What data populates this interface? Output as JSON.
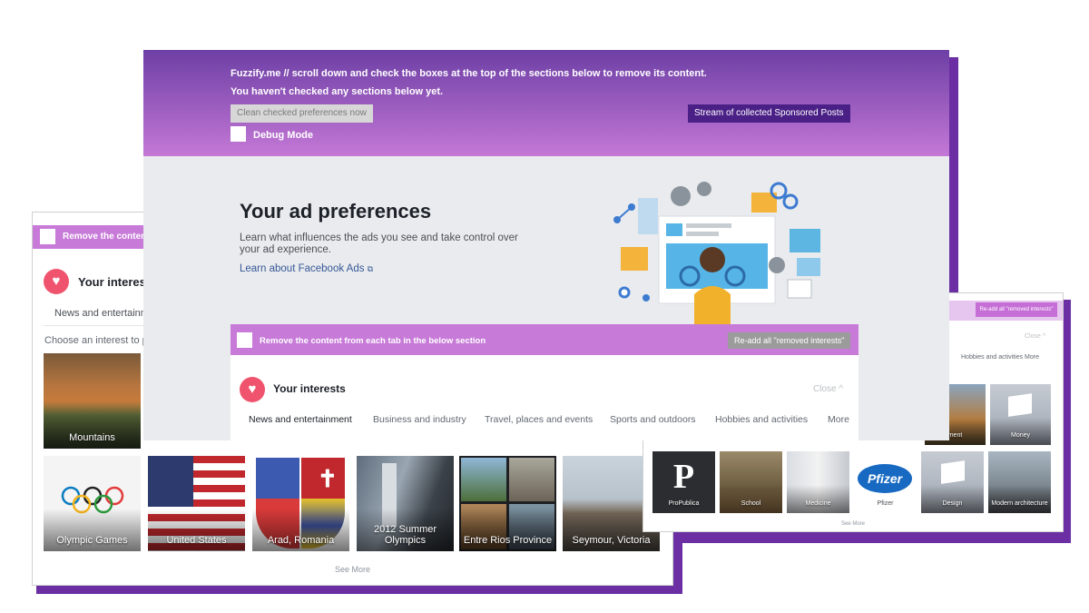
{
  "header": {
    "line1": "Fuzzify.me // scroll down and check the boxes at the top of the sections below to remove its content.",
    "line2": "You haven't checked any sections below yet.",
    "clean_button": "Clean checked preferences now",
    "stream_button": "Stream of collected Sponsored Posts",
    "debug_label": "Debug Mode"
  },
  "ad_prefs": {
    "title": "Your ad preferences",
    "description": "Learn what influences the ads you see and take control over your ad experience.",
    "link": "Learn about Facebook Ads"
  },
  "main_section": {
    "remove_text": "Remove the content from each tab in the below section",
    "readd_button": "Re-add all \"removed interests\"",
    "interests_title": "Your interests",
    "close": "Close",
    "tabs": [
      "News and entertainment",
      "Business and industry",
      "Travel, places and events",
      "Sports and outdoors",
      "Hobbies and activities",
      "More"
    ]
  },
  "left_card": {
    "remove_text": "Remove the content f",
    "interests_title": "Your interest",
    "tab": "News and entertainm",
    "choose": "Choose an interest to pr",
    "tiles": [
      "Mountains",
      "Olympic Games",
      "United States",
      "Arad, Romania",
      "2012 Summer Olympics",
      "Entre Rios Province",
      "Seymour, Victoria"
    ],
    "see_more": "See More"
  },
  "right_card": {
    "readd_button": "Re-add all \"removed interests\"",
    "close": "Close",
    "tabs": "Hobbies and activities    More",
    "tiles": [
      "ment",
      "Money",
      "ProPublica",
      "School",
      "Medicine",
      "Pfizer",
      "Design",
      "Modern architecture"
    ],
    "see_more": "See More"
  },
  "colors": {
    "header_top": "#6d3fa5",
    "header_bottom": "#c478d6",
    "accent_purple": "#6b2fa3",
    "remove_bar": "#c77ad8",
    "heart": "#f0536d"
  }
}
